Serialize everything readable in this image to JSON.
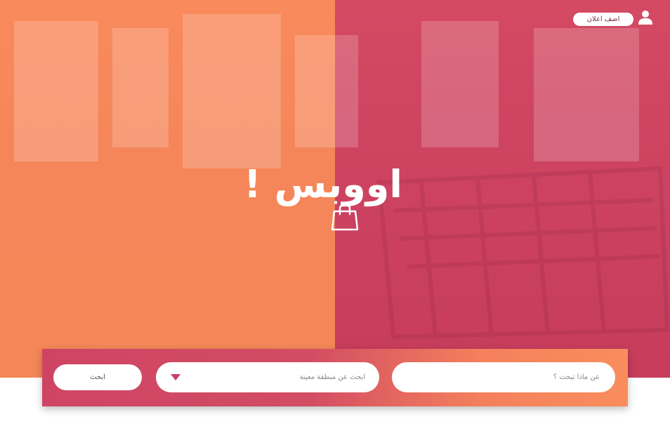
{
  "header": {
    "add_ad_label": "اضف اعلان",
    "user_icon": "user-icon"
  },
  "hero": {
    "logo_text": "اووبس !",
    "logo_icon": "shopping-bag-icon",
    "colors": {
      "left_half": "#f98a5c",
      "right_half": "#cc4260"
    }
  },
  "search": {
    "query_placeholder": "عن ماذا تبحث ؟",
    "region_placeholder": "ابحث عن منطقة معينة",
    "region_icon": "chevron-down-icon",
    "submit_label": "ابحث"
  }
}
